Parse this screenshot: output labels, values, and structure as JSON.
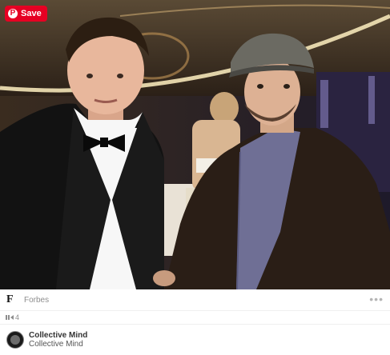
{
  "save_button": {
    "label": "Save",
    "logo": "P"
  },
  "source": {
    "logo_letter": "F",
    "name": "Forbes",
    "more": "•••"
  },
  "stats": {
    "repins": "4"
  },
  "board": {
    "owner": "Collective Mind",
    "name": "Collective Mind"
  },
  "colors": {
    "save_red": "#e60023",
    "muted_text": "#8e8e8e",
    "divider": "#efefef"
  },
  "icons": [
    "pinterest-logo-icon",
    "more-dots-icon",
    "repin-icon",
    "avatar"
  ]
}
